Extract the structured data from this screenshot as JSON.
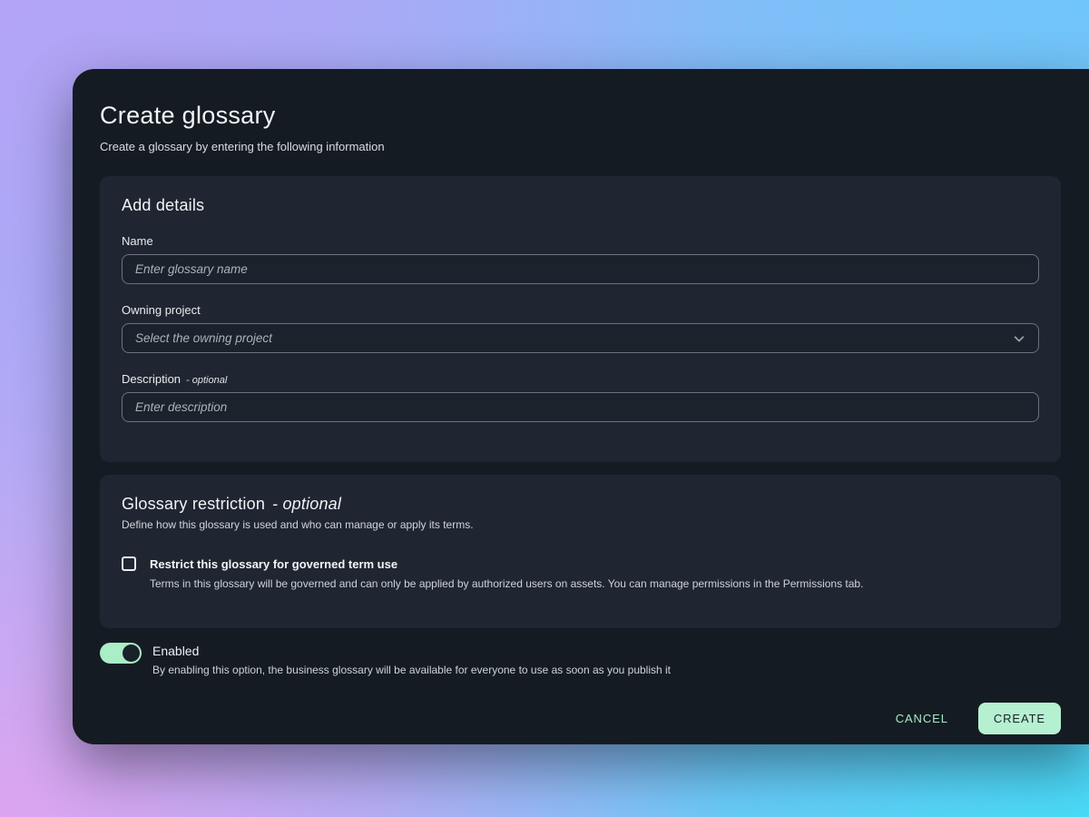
{
  "modal": {
    "title": "Create glossary",
    "subtitle": "Create a glossary by entering the following information",
    "details": {
      "heading": "Add details",
      "name_label": "Name",
      "name_placeholder": "Enter glossary name",
      "project_label": "Owning project",
      "project_placeholder": "Select the owning project",
      "description_label": "Description",
      "description_optional": "- optional",
      "description_placeholder": "Enter description"
    },
    "restriction": {
      "heading": "Glossary restriction",
      "optional": "- optional",
      "subheading": "Define how this glossary is used and who can manage or apply its terms.",
      "checkbox_label": "Restrict this glossary for governed term use",
      "checkbox_checked": false,
      "checkbox_description": "Terms in this glossary will be governed and can only be applied by authorized users on assets. You can manage permissions in the Permissions tab."
    },
    "toggle": {
      "label": "Enabled",
      "state_on": true,
      "description": "By enabling this option, the business glossary will be available for everyone to use as soon as you publish it"
    },
    "footer": {
      "cancel": "CANCEL",
      "create": "CREATE"
    }
  },
  "colors": {
    "accent_mint": "#b5f1d0",
    "modal_bg": "#151b23",
    "card_bg": "#1f2631",
    "gradient_top_left": "#b3a3f6",
    "gradient_top_right": "#6fc5f9",
    "gradient_bottom_left": "#dda4f0",
    "gradient_bottom_right": "#49dbf9"
  }
}
